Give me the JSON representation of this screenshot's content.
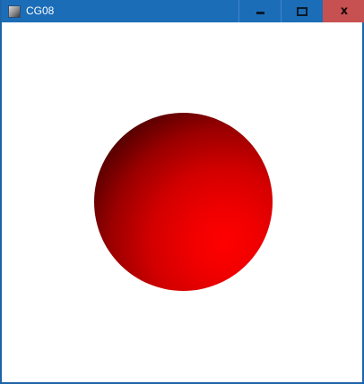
{
  "window": {
    "title": "CG08",
    "app_icon": "app-icon"
  },
  "caption_buttons": {
    "minimize_icon": "minimize-icon",
    "maximize_icon": "maximize-icon",
    "close_icon": "close-icon",
    "close_glyph": "x"
  },
  "scene": {
    "object": "sphere",
    "color": "#ff0000",
    "background": "#ffffff"
  },
  "colors": {
    "titlebar": "#1c6db8",
    "close_button": "#c75050"
  }
}
